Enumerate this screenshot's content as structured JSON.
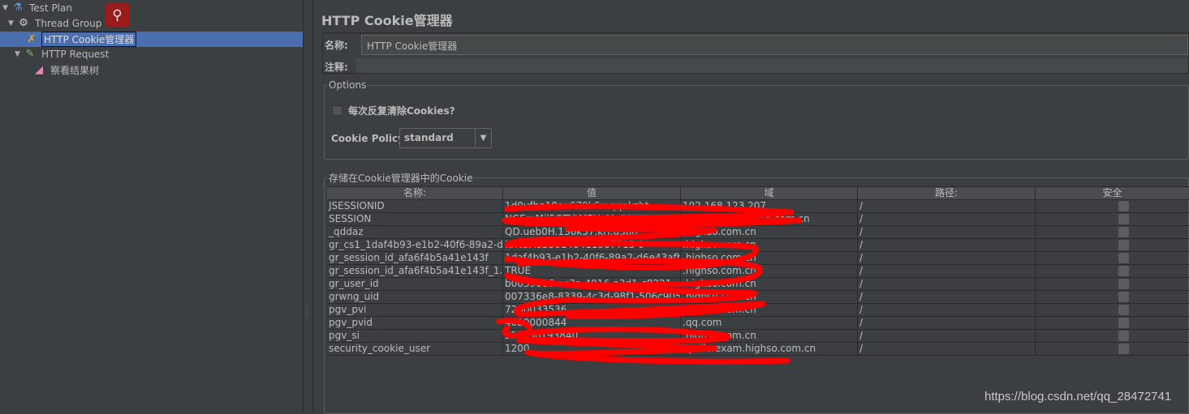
{
  "tree": {
    "items": [
      {
        "label": "Test Plan",
        "icon": "flask-icon"
      },
      {
        "label": "Thread Group",
        "icon": "gear-icon"
      },
      {
        "label": "HTTP Cookie管理器",
        "icon": "wrench-screwdriver-icon",
        "selected": true
      },
      {
        "label": "HTTP Request",
        "icon": "pipette-icon"
      },
      {
        "label": "察看结果树",
        "icon": "chart-icon"
      }
    ]
  },
  "search_icon": "magnifier-icon",
  "panel": {
    "title": "HTTP Cookie管理器",
    "name_label": "名称:",
    "name_value": "HTTP Cookie管理器",
    "comment_label": "注释:",
    "comment_value": "",
    "options_legend": "Options",
    "clear_each_iteration_label": "每次反复清除Cookies?",
    "clear_each_iteration_checked": false,
    "policy_label": "Cookie Policy:",
    "policy_value": "standard",
    "cookies_legend": "存储在Cookie管理器中的Cookie"
  },
  "table": {
    "headers": [
      "名称:",
      "值",
      "域",
      "路径:",
      "安全"
    ],
    "rows": [
      {
        "name": "JSESSIONID",
        "value": "1d0ufho18ou679k6mqqnkzht",
        "domain": "192.168.123.207",
        "path": "/",
        "secure": false
      },
      {
        "name": "SESSION",
        "value": "NGEmMil5OTYtMDYyMy00MDU2LWI1...",
        "domain": "apollo.exm.highso.com.cn",
        "path": "/",
        "secure": false
      },
      {
        "name": "_qddaz",
        "value": "QD.ueb0H.136k57.krj.u3po",
        "domain": ".highso.com.cn",
        "path": "/",
        "secure": false
      },
      {
        "name": "gr_cs1_1daf4b93-e1b2-40f6-89a2-d...",
        "value": "id%3A8550140411907715 0",
        "domain": ".highso.com.cn",
        "path": "/",
        "secure": false
      },
      {
        "name": "gr_session_id_afa6f4b5a41e143f",
        "value": "1daf4b93-e1b2-40f6-89a2-d6e43afb6",
        "domain": ".highso.com.cn",
        "path": "/",
        "secure": false
      },
      {
        "name": "gr_session_id_afa6f4b5a41e143f_1...",
        "value": "TRUE",
        "domain": ".highso.com.cn",
        "path": "/",
        "secure": false
      },
      {
        "name": "gr_user_id",
        "value": "b0039066-ac3a-4916-a3d1-c8221... ",
        "domain": ".highso.com.cn",
        "path": "/",
        "secure": false
      },
      {
        "name": "grwng_uid",
        "value": "007336e8-8339-4c3d-98f1-506c9052...",
        "domain": ".highso.com.cn",
        "path": "/",
        "secure": false
      },
      {
        "name": "pgv_pvi",
        "value": "7260033536",
        "domain": ".highso.com.cn",
        "path": "/",
        "secure": false
      },
      {
        "name": "pgv_pvid",
        "value": "4020000844",
        "domain": ".qq.com",
        "path": "/",
        "secure": false
      },
      {
        "name": "pgv_si",
        "value": "s61530193840",
        "domain": ".highso.com.cn",
        "path": "/",
        "secure": false
      },
      {
        "name": "security_cookie_user",
        "value": "1200...",
        "domain": "apollo.exam.highso.com.cn",
        "path": "/",
        "secure": false
      }
    ]
  },
  "watermark": "https://blog.csdn.net/qq_28472741",
  "colors": {
    "selection": "#4b6eaf",
    "scribble": "#ff0000",
    "background": "#3c3f41"
  }
}
